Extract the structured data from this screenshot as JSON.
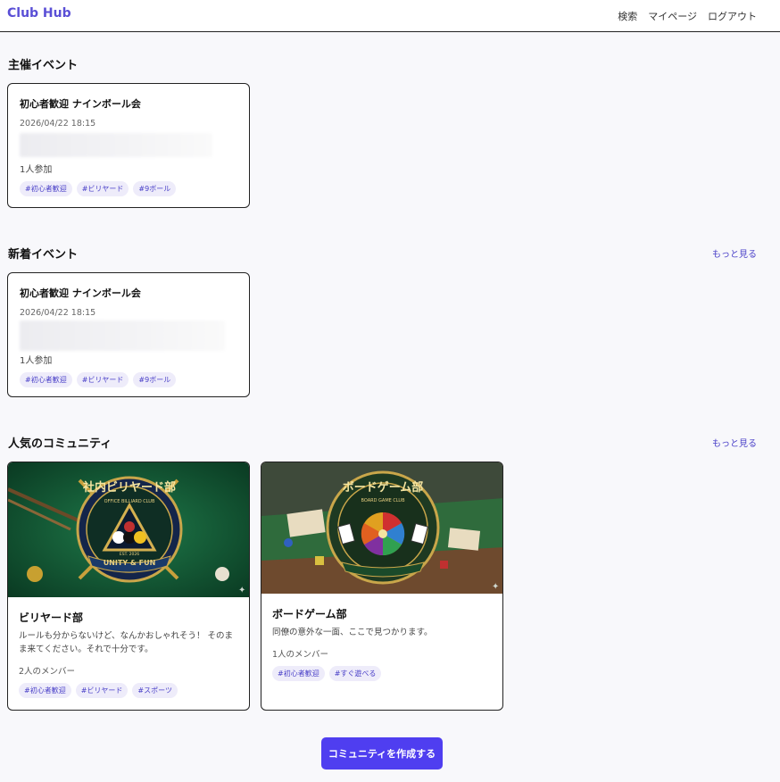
{
  "header": {
    "logo": "Club Hub",
    "nav": {
      "search": "検索",
      "mypage": "マイページ",
      "logout": "ログアウト"
    }
  },
  "hosted": {
    "title": "主催イベント",
    "event": {
      "title": "初心者歓迎 ナインボール会",
      "date": "2026/04/22 18:15",
      "participants": "1人参加",
      "tags": [
        "#初心者歓迎",
        "#ビリヤード",
        "#9ボール"
      ]
    }
  },
  "new_events": {
    "title": "新着イベント",
    "more": "もっと見る",
    "event": {
      "title": "初心者歓迎 ナインボール会",
      "date": "2026/04/22 18:15",
      "participants": "1人参加",
      "tags": [
        "#初心者歓迎",
        "#ビリヤード",
        "#9ボール"
      ]
    }
  },
  "popular": {
    "title": "人気のコミュニティ",
    "more": "もっと見る",
    "communities": [
      {
        "name": "ビリヤード部",
        "description": "ルールも分からないけど、なんかおしゃれそう！ そのまま来てください。それで十分です。",
        "members": "2人のメンバー",
        "tags": [
          "#初心者歓迎",
          "#ビリヤード",
          "#スポーツ"
        ],
        "logo_text": "社内ビリヤード部",
        "logo_sub": "OFFICE BILLIARD CLUB",
        "logo_ribbon": "UNITY & FUN",
        "logo_est": "EST. 2026"
      },
      {
        "name": "ボードゲーム部",
        "description": "同僚の意外な一面、ここで見つかります。",
        "members": "1人のメンバー",
        "tags": [
          "#初心者歓迎",
          "#すぐ遊べる"
        ],
        "logo_text": "ボードゲーム部",
        "logo_sub": "BOARD GAME CLUB"
      }
    ]
  },
  "create_button": "コミュニティを作成する",
  "colors": {
    "accent": "#4f3ef0",
    "logo": "#5a4fd6",
    "tag_bg": "#eeecfa"
  }
}
